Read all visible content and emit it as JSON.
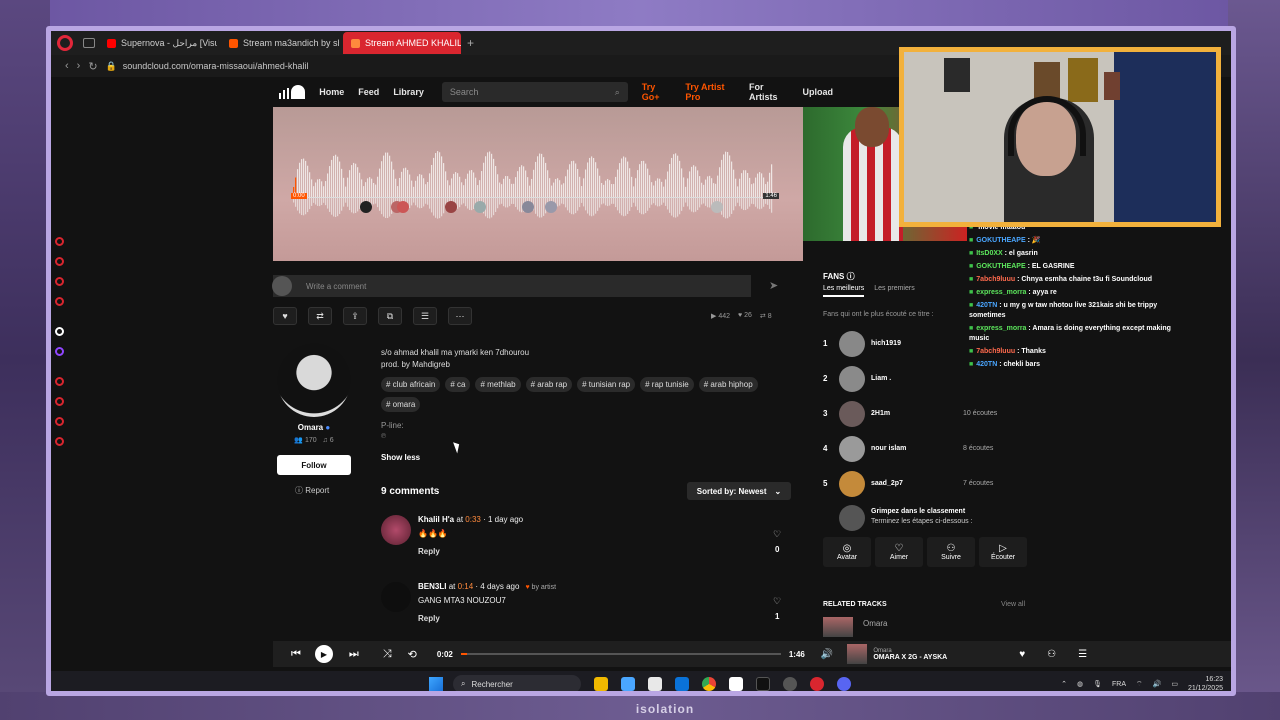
{
  "browser": {
    "tabs": [
      {
        "label": "Supernova - مراحل [Visual",
        "active": false
      },
      {
        "label": "Stream ma3andich by sh",
        "active": false
      },
      {
        "label": "Stream AHMED KHALIL b",
        "active": true
      }
    ],
    "new_tab": "+",
    "url": "soundcloud.com/omara-missaoui/ahmed-khalil"
  },
  "header": {
    "nav": [
      "Home",
      "Feed",
      "Library"
    ],
    "search_placeholder": "Search",
    "try_go": "Try Go+",
    "try_artist": "Try Artist Pro",
    "for_artists": "For Artists",
    "upload": "Upload"
  },
  "waveform": {
    "current": "0:00",
    "duration": "1:46"
  },
  "comment_input": {
    "placeholder": "Write a comment"
  },
  "stats": {
    "plays": "442",
    "likes": "26",
    "reposts": "8"
  },
  "artist": {
    "name": "Omara",
    "followers": "170",
    "tracks": "6",
    "follow_label": "Follow",
    "report_label": "Report"
  },
  "description": {
    "line1": "s/o ahmad khalil ma ymarki ken 7dhourou",
    "line2": "prod. by Mahdigreb",
    "tags": [
      "# club africain",
      "# ca",
      "# methlab",
      "# arab rap",
      "# tunisian rap",
      "# rap tunisie",
      "# arab hiphop",
      "# omara"
    ],
    "pline": "P-line:",
    "pline_value": "℗",
    "show_less": "Show less"
  },
  "comments": {
    "count_label": "9 comments",
    "sort_label": "Sorted by: Newest",
    "items": [
      {
        "user": "Khalil H'a",
        "at": "at",
        "time": "0:33",
        "ago": "· 1 day ago",
        "text": "🔥🔥🔥",
        "reply": "Reply",
        "likes": "0",
        "by_artist": ""
      },
      {
        "user": "BEN3LI",
        "at": "at",
        "time": "0:14",
        "ago": "· 4 days ago",
        "text": "GANG MTA3 NOUZOU7",
        "reply": "Reply",
        "likes": "1",
        "by_artist": "by artist"
      }
    ]
  },
  "fans": {
    "title": "FANS",
    "tab_best": "Les meilleurs",
    "tab_first": "Les premiers",
    "note": "Fans qui ont le plus écouté ce titre :",
    "list": [
      {
        "rank": "1",
        "name": "hich1919",
        "count": ""
      },
      {
        "rank": "2",
        "name": "Liam .",
        "count": ""
      },
      {
        "rank": "3",
        "name": "2H1m",
        "count": "10 écoutes"
      },
      {
        "rank": "4",
        "name": "nour islam",
        "count": "8 écoutes"
      },
      {
        "rank": "5",
        "name": "saad_2p7",
        "count": "7 écoutes"
      }
    ],
    "climb_title": "Grimpez dans le classement",
    "climb_sub": "Terminez les étapes ci-dessous :",
    "steps": [
      {
        "icon": "◎",
        "label": "Avatar"
      },
      {
        "icon": "♡",
        "label": "Aimer"
      },
      {
        "icon": "⚇",
        "label": "Suivre"
      },
      {
        "icon": "▷",
        "label": "Écouter"
      }
    ]
  },
  "related": {
    "title": "RELATED TRACKS",
    "view_all": "View all",
    "artist": "Omara"
  },
  "chat": [
    {
      "user": "",
      "text": "movie mtaaou"
    },
    {
      "user": "GOKUTHEAPE",
      "text": ": 🎉"
    },
    {
      "user": "ItsD0XX",
      "text": ": el gasrin"
    },
    {
      "user": "GOKUTHEAPE",
      "text": ": EL GASRINE"
    },
    {
      "user": "7abch9luuu",
      "text": ": Chnya esmha chaine t3u fi Soundcloud"
    },
    {
      "user": "express_morra",
      "text": ": ayya re"
    },
    {
      "user": "420TN",
      "text": ": u my g w taw nhotou live 321kais shi be trippy sometimes"
    },
    {
      "user": "express_morra",
      "text": ": Amara is doing everything except making music"
    },
    {
      "user": "7abch9luuu",
      "text": ": Thanks"
    },
    {
      "user": "420TN",
      "text": ": chekli bars"
    }
  ],
  "player": {
    "current": "0:02",
    "duration": "1:46",
    "progress": 0.02,
    "track_artist": "Omara",
    "track_title": "OMARA X 2G - AYSKA"
  },
  "taskbar": {
    "search": "Rechercher",
    "lang": "FRA",
    "time": "16:23",
    "date": "21/12/2025"
  },
  "background_logo": "isolation"
}
